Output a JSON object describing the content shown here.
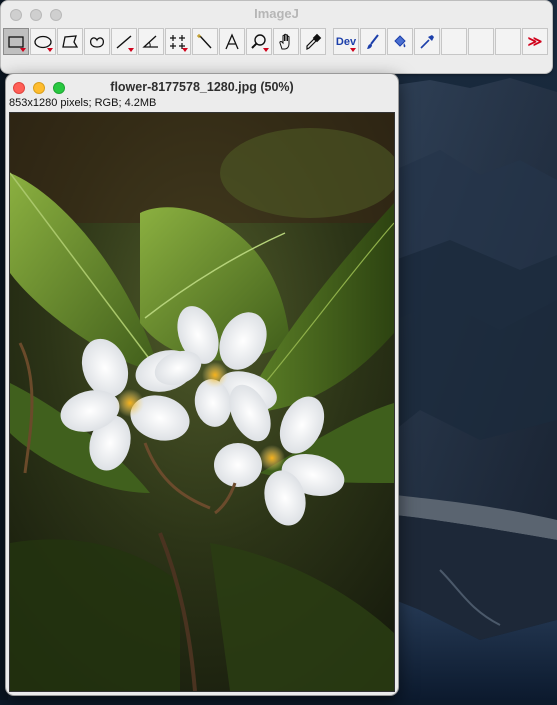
{
  "imagej": {
    "title": "ImageJ",
    "tools": [
      {
        "name": "rectangle-tool",
        "selected": true,
        "submenu": true,
        "icon": "rectangle-selection-icon"
      },
      {
        "name": "oval-tool",
        "selected": false,
        "submenu": true,
        "icon": "oval-selection-icon"
      },
      {
        "name": "polygon-tool",
        "selected": false,
        "submenu": false,
        "icon": "polygon-selection-icon"
      },
      {
        "name": "freehand-tool",
        "selected": false,
        "submenu": false,
        "icon": "freehand-selection-icon"
      },
      {
        "name": "line-tool",
        "selected": false,
        "submenu": true,
        "icon": "straight-line-icon"
      },
      {
        "name": "angle-tool",
        "selected": false,
        "submenu": false,
        "icon": "angle-icon"
      },
      {
        "name": "point-tool",
        "selected": false,
        "submenu": true,
        "icon": "multi-point-icon"
      },
      {
        "name": "wand-tool",
        "selected": false,
        "submenu": false,
        "icon": "wand-icon"
      },
      {
        "name": "text-tool",
        "selected": false,
        "submenu": false,
        "icon": "text-A-icon"
      },
      {
        "name": "magnifier-tool",
        "selected": false,
        "submenu": true,
        "icon": "magnifier-icon"
      },
      {
        "name": "hand-tool",
        "selected": false,
        "submenu": false,
        "icon": "hand-icon"
      },
      {
        "name": "color-picker-tool",
        "selected": false,
        "submenu": false,
        "icon": "eyedropper-icon"
      }
    ],
    "dev_label": "Dev",
    "more_tools_symbol": "≫"
  },
  "image_window": {
    "title": "flower-8177578_1280.jpg (50%)",
    "info": "853x1280 pixels; RGB; 4.2MB"
  },
  "colors": {
    "toolbar_bg": "#ececec",
    "selected_tool": "#bfbfbf",
    "submenu_arrow": "#d0021b",
    "dev_text": "#1c3faa",
    "desktop_dark": "#0d1b2b"
  }
}
